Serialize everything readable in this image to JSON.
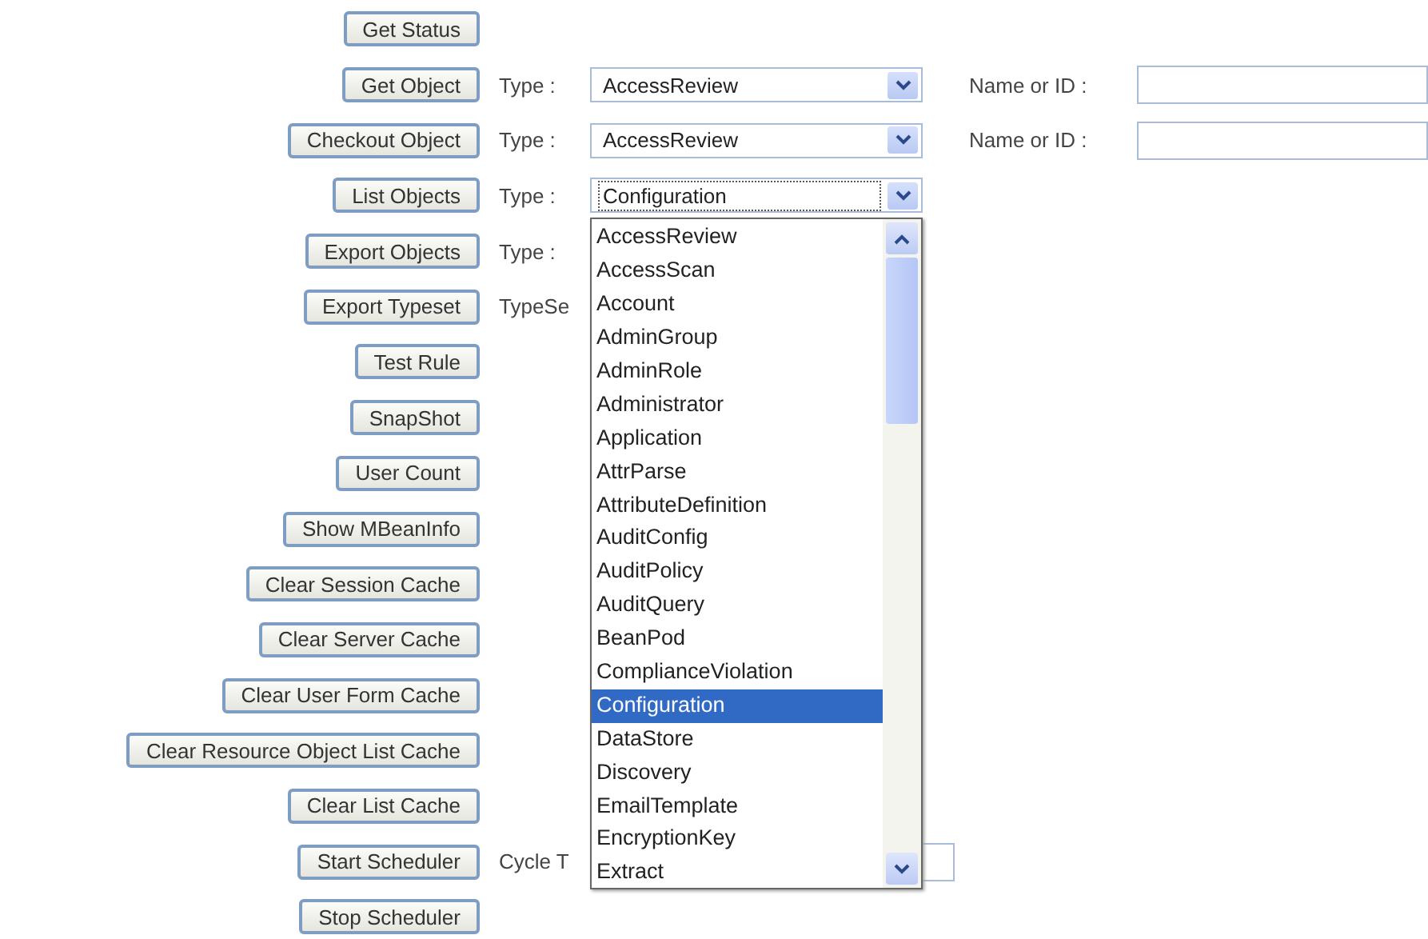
{
  "rows": [
    {
      "kind": "plain",
      "button": "Get Status"
    },
    {
      "kind": "object",
      "button": "Get Object",
      "type_label": "Type :",
      "type_value": "AccessReview",
      "name_label": "Name or ID :"
    },
    {
      "kind": "object",
      "button": "Checkout Object",
      "type_label": "Type :",
      "type_value": "AccessReview",
      "name_label": "Name or ID :"
    },
    {
      "kind": "list",
      "button": "List Objects",
      "type_label": "Type :",
      "type_value": "Configuration",
      "dropdown": {
        "options": [
          {
            "label": "AccessReview",
            "selected": false
          },
          {
            "label": "AccessScan",
            "selected": false
          },
          {
            "label": "Account",
            "selected": false
          },
          {
            "label": "AdminGroup",
            "selected": false
          },
          {
            "label": "AdminRole",
            "selected": false
          },
          {
            "label": "Administrator",
            "selected": false
          },
          {
            "label": "Application",
            "selected": false
          },
          {
            "label": "AttrParse",
            "selected": false
          },
          {
            "label": "AttributeDefinition",
            "selected": false
          },
          {
            "label": "AuditConfig",
            "selected": false
          },
          {
            "label": "AuditPolicy",
            "selected": false
          },
          {
            "label": "AuditQuery",
            "selected": false
          },
          {
            "label": "BeanPod",
            "selected": false
          },
          {
            "label": "ComplianceViolation",
            "selected": false
          },
          {
            "label": "Configuration",
            "selected": true
          },
          {
            "label": "DataStore",
            "selected": false
          },
          {
            "label": "Discovery",
            "selected": false
          },
          {
            "label": "EmailTemplate",
            "selected": false
          },
          {
            "label": "EncryptionKey",
            "selected": false
          },
          {
            "label": "Extract",
            "selected": false
          }
        ]
      }
    },
    {
      "kind": "label",
      "button": "Export Objects",
      "label": "Type :"
    },
    {
      "kind": "label",
      "button": "Export Typeset",
      "label": "TypeSe"
    },
    {
      "kind": "plain",
      "button": "Test Rule"
    },
    {
      "kind": "plain",
      "button": "SnapShot"
    },
    {
      "kind": "plain",
      "button": "User Count"
    },
    {
      "kind": "plain",
      "button": "Show MBeanInfo"
    },
    {
      "kind": "plain",
      "button": "Clear Session Cache"
    },
    {
      "kind": "plain",
      "button": "Clear Server Cache"
    },
    {
      "kind": "plain",
      "button": "Clear User Form Cache"
    },
    {
      "kind": "plain",
      "button": "Clear Resource Object List Cache"
    },
    {
      "kind": "plain",
      "button": "Clear List Cache"
    },
    {
      "kind": "field",
      "button": "Start Scheduler",
      "label": "Cycle T"
    },
    {
      "kind": "plain",
      "button": "Stop Scheduler"
    }
  ]
}
